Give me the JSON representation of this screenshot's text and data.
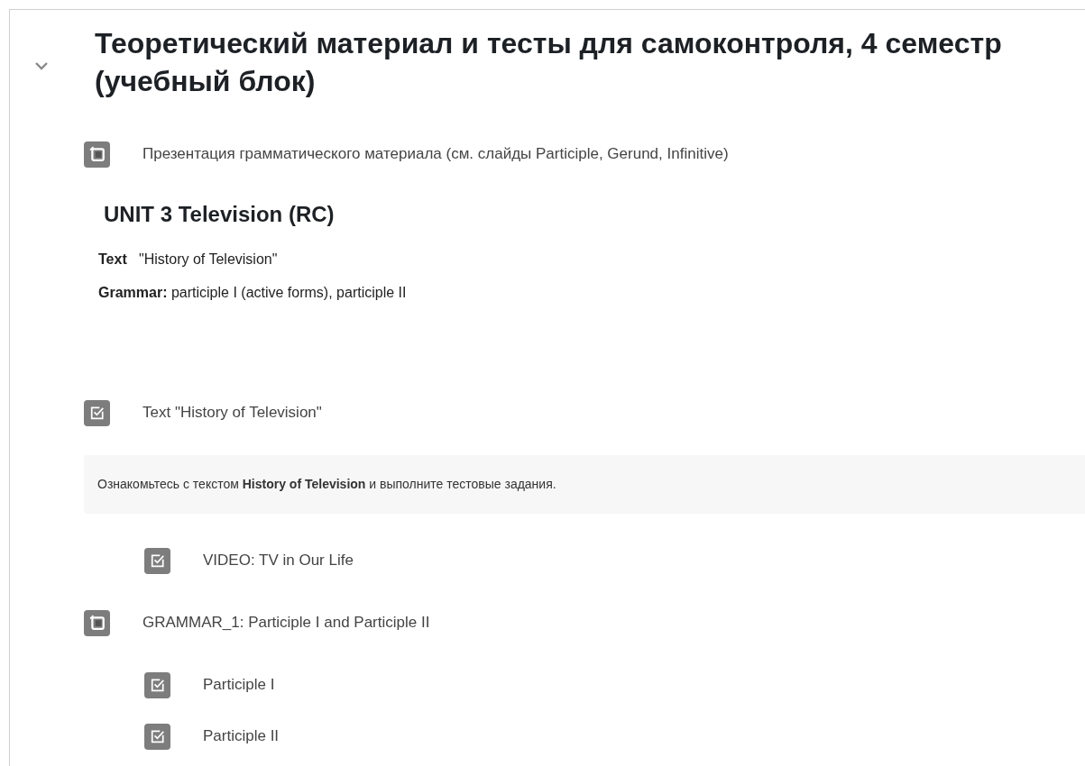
{
  "section": {
    "expanded": true,
    "title": "Теоретический материал и тесты для самоконтроля, 4 семестр (учебный блок)"
  },
  "items": [
    {
      "kind": "presentation",
      "name": "Презентация грамматического материала (см. слайды Participle, Gerund, Infinitive)"
    },
    {
      "kind": "heading",
      "text": "**UNIT 3 Television (RC)**"
    },
    {
      "kind": "paragraph",
      "text": "**Text**   \"History of Television\""
    },
    {
      "kind": "paragraph",
      "text": "**Grammar:** participle I (active forms), participle II"
    },
    {
      "kind": "quiz",
      "name": "Text \"History of Television\"",
      "description": "Ознакомьтесь с текстом **History of Television** и выполните тестовые задания.",
      "children": [
        {
          "kind": "quiz",
          "name": "VIDEO: TV in Our Life"
        }
      ]
    },
    {
      "kind": "presentation",
      "name": "GRAMMAR_1: Participle I and Participle II",
      "children": [
        {
          "kind": "quiz",
          "name": "Participle I"
        },
        {
          "kind": "quiz",
          "name": "Participle II"
        }
      ]
    }
  ]
}
